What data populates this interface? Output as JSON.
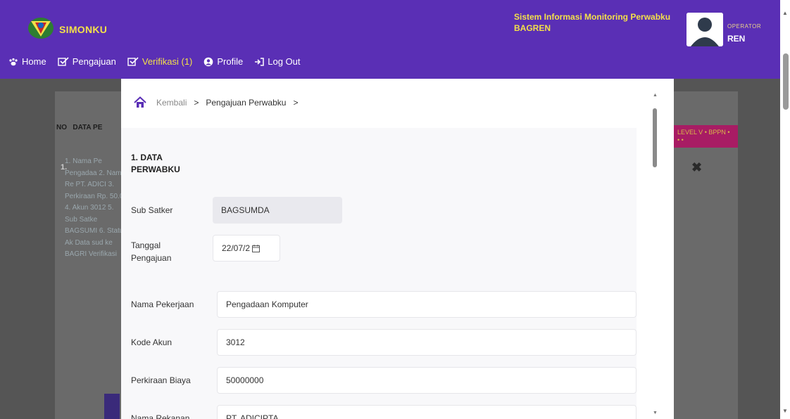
{
  "header": {
    "brand": "SIMONKU",
    "system_title": "Sistem Informasi Monitoring Perwabku BAGREN",
    "role": "OPERATOR",
    "username": "REN",
    "bg_color": "#5a2fb5",
    "accent_color": "#f3e04a"
  },
  "nav": {
    "items": [
      {
        "label": "Home",
        "icon": "paw-icon"
      },
      {
        "label": "Pengajuan",
        "icon": "check-square-icon"
      },
      {
        "label": "Verifikasi (1)",
        "icon": "check-square-icon"
      },
      {
        "label": "Profile",
        "icon": "user-circle-icon"
      },
      {
        "label": "Log Out",
        "icon": "logout-icon"
      }
    ]
  },
  "background_page": {
    "col_no": "NO",
    "col_data": "DATA PE",
    "row_number": "1.",
    "row_text": "1. Nama Pe Pengadaa 2. Nama Re PT. ADICI 3. Perkiraan Rp. 50.00 4. Akun 3012 5. Sub Satke BAGSUMI 6. Status Ak Data sud ke BAGRI Verifikasi",
    "badge": "LEVEL V • BPPN • • •",
    "status_mark": "✖"
  },
  "modal": {
    "breadcrumb": {
      "back": "Kembali",
      "current": "Pengajuan Perwabku",
      "separator": ">"
    },
    "section_title": "1. DATA PERWABKU",
    "fields": [
      {
        "label": "Sub Satker",
        "value": "BAGSUMDA"
      },
      {
        "label": "Tanggal Pengajuan",
        "value": "22/07/2"
      },
      {
        "label": "Nama Pekerjaan",
        "value": "Pengadaan Komputer"
      },
      {
        "label": "Kode Akun",
        "value": "3012"
      },
      {
        "label": "Perkiraan Biaya",
        "value": "50000000"
      },
      {
        "label": "Nama Rekanan",
        "value": "PT. ADICIPTA"
      }
    ]
  }
}
